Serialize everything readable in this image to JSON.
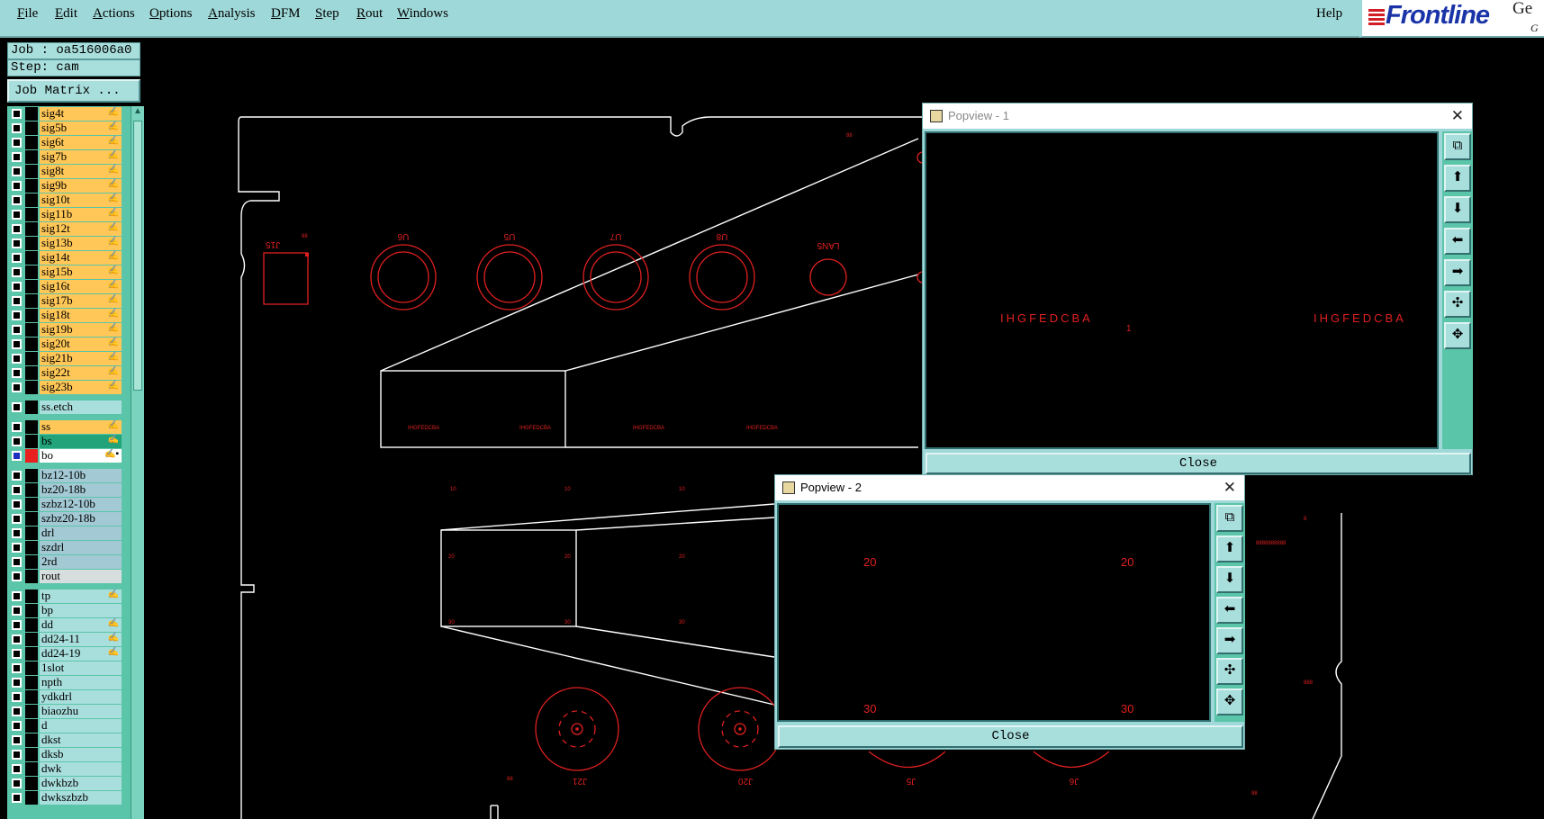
{
  "menu": {
    "items": [
      "File",
      "Edit",
      "Actions",
      "Options",
      "Analysis",
      "DFM",
      "Step",
      "Rout",
      "Windows"
    ],
    "help": "Help",
    "logo": "Frontline",
    "logo_suffix": "Ge",
    "logo_suffix2": "G"
  },
  "job": {
    "job_label": "Job : oa516006a0",
    "step_label": "Step: cam",
    "matrix_button": "Job Matrix ..."
  },
  "layers": [
    {
      "name": "sig4t",
      "color": "#ffc757",
      "mark": "✍"
    },
    {
      "name": "sig5b",
      "color": "#ffc757",
      "mark": "✍"
    },
    {
      "name": "sig6t",
      "color": "#ffc757",
      "mark": "✍"
    },
    {
      "name": "sig7b",
      "color": "#ffc757",
      "mark": "✍"
    },
    {
      "name": "sig8t",
      "color": "#ffc757",
      "mark": "✍"
    },
    {
      "name": "sig9b",
      "color": "#ffc757",
      "mark": "✍"
    },
    {
      "name": "sig10t",
      "color": "#ffc757",
      "mark": "✍"
    },
    {
      "name": "sig11b",
      "color": "#ffc757",
      "mark": "✍"
    },
    {
      "name": "sig12t",
      "color": "#ffc757",
      "mark": "✍"
    },
    {
      "name": "sig13b",
      "color": "#ffc757",
      "mark": "✍"
    },
    {
      "name": "sig14t",
      "color": "#ffc757",
      "mark": "✍"
    },
    {
      "name": "sig15b",
      "color": "#ffc757",
      "mark": "✍"
    },
    {
      "name": "sig16t",
      "color": "#ffc757",
      "mark": "✍"
    },
    {
      "name": "sig17b",
      "color": "#ffc757",
      "mark": "✍"
    },
    {
      "name": "sig18t",
      "color": "#ffc757",
      "mark": "✍"
    },
    {
      "name": "sig19b",
      "color": "#ffc757",
      "mark": "✍"
    },
    {
      "name": "sig20t",
      "color": "#ffc757",
      "mark": "✍"
    },
    {
      "name": "sig21b",
      "color": "#ffc757",
      "mark": "✍"
    },
    {
      "name": "sig22t",
      "color": "#ffc757",
      "mark": "✍"
    },
    {
      "name": "sig23b",
      "color": "#ffc757",
      "mark": "✍"
    },
    {
      "name": "ss.etch",
      "color": "#a8dedc",
      "mark": ""
    },
    {
      "name": "ss",
      "color": "#ffc757",
      "mark": "✍"
    },
    {
      "name": "bs",
      "color": "#22a37a",
      "mark": "✍"
    },
    {
      "name": "bo",
      "color": "#ffffff",
      "mark": "✍▪"
    },
    {
      "name": "bz12-10b",
      "color": "#a3c9d4",
      "mark": ""
    },
    {
      "name": "bz20-18b",
      "color": "#a3c9d4",
      "mark": ""
    },
    {
      "name": "szbz12-10b",
      "color": "#a3c9d4",
      "mark": ""
    },
    {
      "name": "szbz20-18b",
      "color": "#a3c9d4",
      "mark": ""
    },
    {
      "name": "drl",
      "color": "#a3c9d4",
      "mark": ""
    },
    {
      "name": "szdrl",
      "color": "#a3c9d4",
      "mark": ""
    },
    {
      "name": "2rd",
      "color": "#a3c9d4",
      "mark": ""
    },
    {
      "name": "rout",
      "color": "#d7dede",
      "mark": ""
    },
    {
      "name": "tp",
      "color": "#a8dedc",
      "mark": "✍"
    },
    {
      "name": "bp",
      "color": "#a8dedc",
      "mark": ""
    },
    {
      "name": "dd",
      "color": "#a8dedc",
      "mark": "✍"
    },
    {
      "name": "dd24-11",
      "color": "#a8dedc",
      "mark": "✍"
    },
    {
      "name": "dd24-19",
      "color": "#a8dedc",
      "mark": "✍"
    },
    {
      "name": "1slot",
      "color": "#a8dedc",
      "mark": ""
    },
    {
      "name": "npth",
      "color": "#a8dedc",
      "mark": ""
    },
    {
      "name": "ydkdrl",
      "color": "#a8dedc",
      "mark": ""
    },
    {
      "name": "biaozhu",
      "color": "#a8dedc",
      "mark": ""
    },
    {
      "name": "d",
      "color": "#a8dedc",
      "mark": ""
    },
    {
      "name": "dkst",
      "color": "#a8dedc",
      "mark": ""
    },
    {
      "name": "dksb",
      "color": "#a8dedc",
      "mark": ""
    },
    {
      "name": "dwk",
      "color": "#a8dedc",
      "mark": ""
    },
    {
      "name": "dwkbzb",
      "color": "#a8dedc",
      "mark": ""
    },
    {
      "name": "dwkszbzb",
      "color": "#a8dedc",
      "mark": ""
    }
  ],
  "canvas_labels": {
    "components": [
      "J15",
      "U6",
      "U5",
      "U7",
      "U8",
      "LAN5",
      "J21",
      "J20",
      "J5",
      "J6"
    ]
  },
  "popview1": {
    "title": "Popview - 1",
    "close": "Close",
    "text_left": "IHGFEDCBA",
    "text_right": "IHGFEDCBA",
    "marker": "1"
  },
  "popview2": {
    "title": "Popview - 2",
    "close": "Close",
    "num_tl": "20",
    "num_tr": "20",
    "num_bl": "30",
    "num_br": "30"
  },
  "colors": {
    "menu_bg": "#9fd8d8",
    "panel_bg": "#5bc5a9",
    "drawing_white": "#ffffff",
    "drawing_red": "#e02020"
  }
}
